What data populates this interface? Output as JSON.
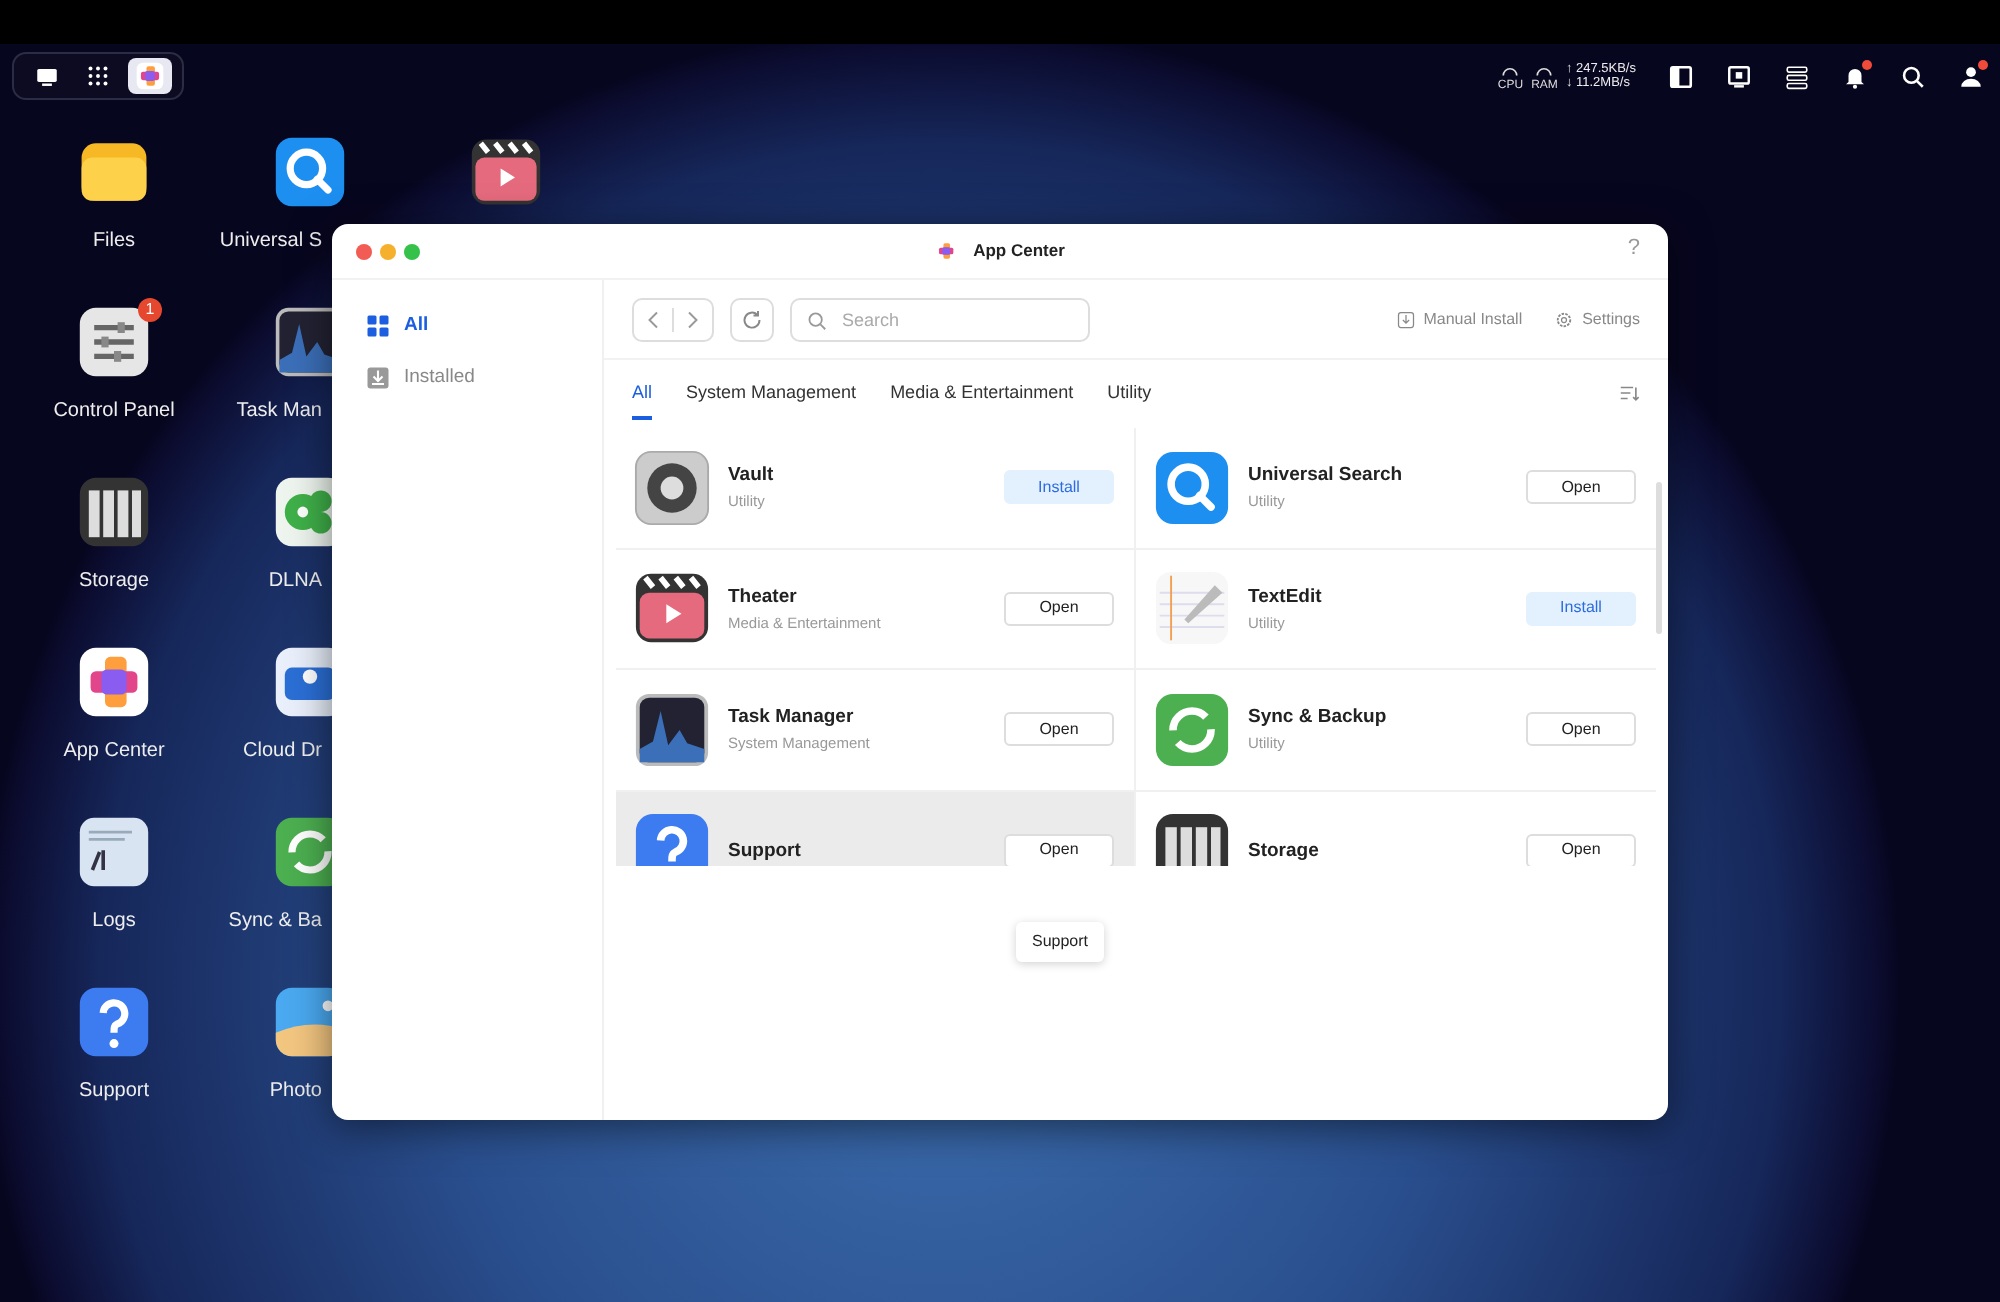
{
  "dock": {
    "items": [
      {
        "kind": "desktop",
        "selected": false
      },
      {
        "kind": "apps",
        "selected": false
      },
      {
        "kind": "appcenter",
        "selected": true
      }
    ]
  },
  "status": {
    "gauges": [
      "CPU",
      "RAM"
    ],
    "upload": "↑ 247.5KB/s",
    "download": "↓ 11.2MB/s",
    "icons": [
      {
        "kind": "panel"
      },
      {
        "kind": "monitor"
      },
      {
        "kind": "list"
      },
      {
        "kind": "bell",
        "dot": true
      },
      {
        "kind": "search"
      },
      {
        "kind": "user",
        "dot": true
      }
    ]
  },
  "desktop_columns": [
    [
      {
        "label": "Files",
        "kind": "files"
      },
      {
        "label": "Control Panel",
        "kind": "control",
        "badge": "1"
      },
      {
        "label": "Storage",
        "kind": "storage"
      },
      {
        "label": "App Center",
        "kind": "appcenter"
      },
      {
        "label": "Logs",
        "kind": "logs"
      },
      {
        "label": "Support",
        "kind": "support"
      }
    ],
    [
      {
        "label": "Universal S",
        "kind": "search"
      },
      {
        "label": "Task Man",
        "kind": "task"
      },
      {
        "label": "DLNA",
        "kind": "dlna"
      },
      {
        "label": "Cloud Dr",
        "kind": "cloud"
      },
      {
        "label": "Sync & Ba",
        "kind": "sync"
      },
      {
        "label": "Photo",
        "kind": "photos"
      }
    ],
    [
      {
        "kind": "theater"
      }
    ]
  ],
  "window": {
    "title": "App Center",
    "help": "?",
    "sidebar": [
      {
        "label": "All",
        "kind": "grid",
        "selected": true
      },
      {
        "label": "Installed",
        "kind": "download",
        "selected": false
      }
    ],
    "search": {
      "placeholder": "Search"
    },
    "actions": [
      {
        "label": "Manual Install",
        "kind": "install"
      },
      {
        "label": "Settings",
        "kind": "gear"
      }
    ],
    "tabs": [
      {
        "label": "All",
        "selected": true
      },
      {
        "label": "System Management",
        "selected": false
      },
      {
        "label": "Media & Entertainment",
        "selected": false
      },
      {
        "label": "Utility",
        "selected": false
      }
    ],
    "apps": [
      {
        "name": "Vault",
        "category": "Utility",
        "kind": "vault",
        "button": "Install",
        "installed": false,
        "hovered": false
      },
      {
        "name": "Universal Search",
        "category": "Utility",
        "kind": "search",
        "button": "Open",
        "installed": true,
        "hovered": false
      },
      {
        "name": "Theater",
        "category": "Media & Entertainment",
        "kind": "theater",
        "button": "Open",
        "installed": true,
        "hovered": false
      },
      {
        "name": "TextEdit",
        "category": "Utility",
        "kind": "textedit",
        "button": "Install",
        "installed": false,
        "hovered": false
      },
      {
        "name": "Task Manager",
        "category": "System Management",
        "kind": "task",
        "button": "Open",
        "installed": true,
        "hovered": false
      },
      {
        "name": "Sync & Backup",
        "category": "Utility",
        "kind": "sync",
        "button": "Open",
        "installed": true,
        "hovered": false
      },
      {
        "name": "Support",
        "kind": "support",
        "button": "Open",
        "installed": true,
        "hovered": true
      },
      {
        "name": "Storage",
        "kind": "storage",
        "button": "Open",
        "installed": true,
        "hovered": false
      }
    ],
    "tooltip": "Support"
  }
}
